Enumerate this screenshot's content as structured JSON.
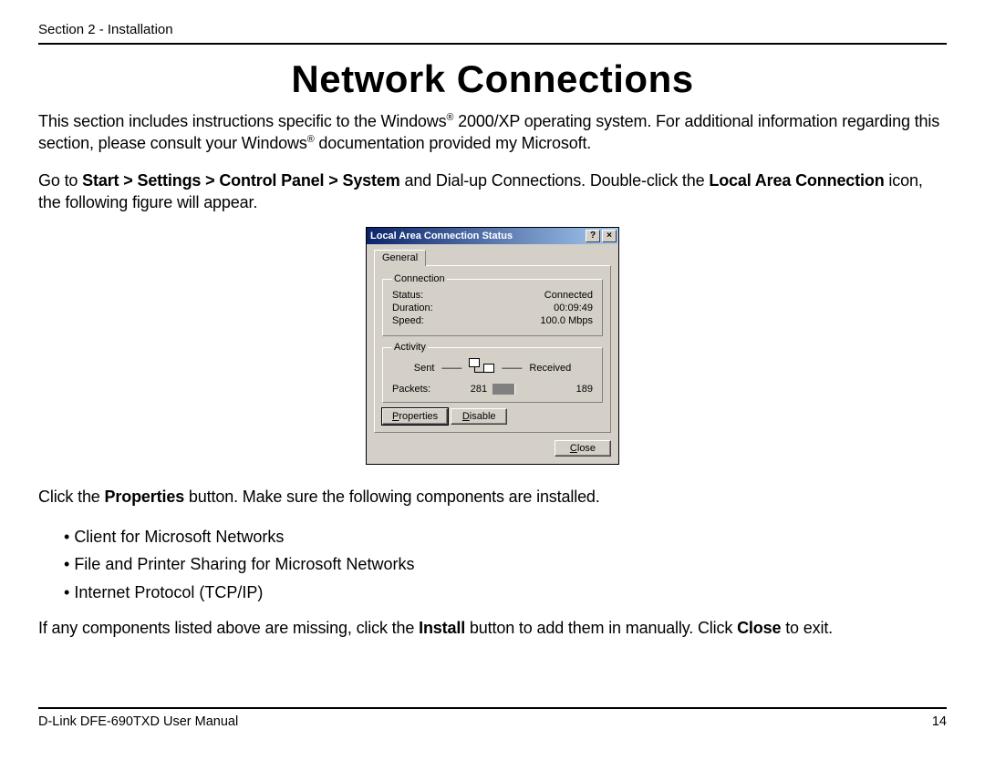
{
  "header": {
    "section": "Section 2 - Installation"
  },
  "title": "Network Connections",
  "para1_a": "This section includes instructions specific to the Windows",
  "para1_b": " 2000/XP operating system. For additional information regarding this section, please consult your Windows",
  "para1_c": " documentation provided my Microsoft.",
  "para2_a": "Go to ",
  "para2_path": "Start > Settings > Control Panel > System",
  "para2_b": " and Dial-up Connections. Double-click the ",
  "para2_lac": "Local Area Connection",
  "para2_c": " icon, the following figure will appear.",
  "dialog": {
    "title": "Local Area Connection Status",
    "help": "?",
    "close_x": "×",
    "tab_general": "General",
    "grp_connection": "Connection",
    "status_label": "Status:",
    "status_value": "Connected",
    "duration_label": "Duration:",
    "duration_value": "00:09:49",
    "speed_label": "Speed:",
    "speed_value": "100.0 Mbps",
    "grp_activity": "Activity",
    "sent": "Sent",
    "received": "Received",
    "packets_label": "Packets:",
    "packets_sent": "281",
    "packets_recv": "189",
    "btn_properties": "Properties",
    "btn_disable": "Disable",
    "btn_close": "Close"
  },
  "para3_a": "Click the ",
  "para3_props": "Properties",
  "para3_b": " button. Make sure the following components are installed.",
  "components": {
    "0": "Client for Microsoft Networks",
    "1": "File and Printer Sharing for Microsoft Networks",
    "2": "Internet Protocol (TCP/IP)"
  },
  "para4_a": "If any components listed above are missing, click the ",
  "para4_install": "Install",
  "para4_b": " button to add them in manually. Click ",
  "para4_close": "Close",
  "para4_c": " to exit.",
  "footer": {
    "left": "D-Link DFE-690TXD User Manual",
    "right": "14"
  }
}
